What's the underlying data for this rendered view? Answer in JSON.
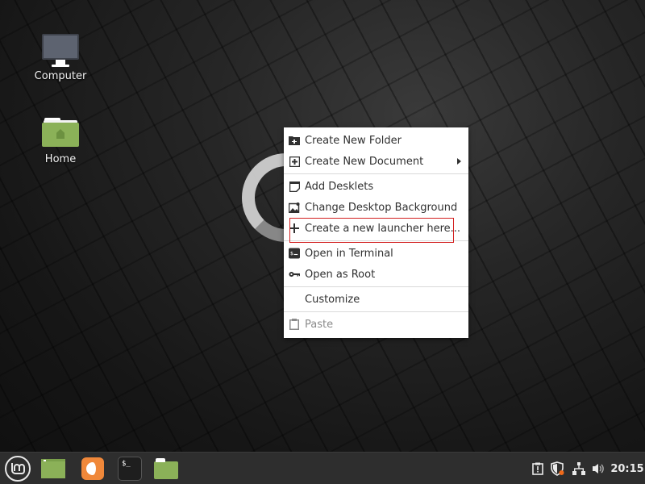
{
  "desktop": {
    "icons": [
      {
        "label": "Computer",
        "icon": "computer-icon"
      },
      {
        "label": "Home",
        "icon": "home-folder-icon"
      }
    ]
  },
  "context_menu": {
    "items": [
      {
        "label": "Create New Folder",
        "icon": "new-folder-icon",
        "enabled": true
      },
      {
        "label": "Create New Document",
        "icon": "new-document-icon",
        "enabled": true,
        "submenu": true
      },
      {
        "label": "Add Desklets",
        "icon": "desklet-icon",
        "enabled": true
      },
      {
        "label": "Change Desktop Background",
        "icon": "image-icon",
        "enabled": true
      },
      {
        "label": "Create a new launcher here...",
        "icon": "plus-icon",
        "enabled": true,
        "highlighted": true
      },
      {
        "label": "Open in Terminal",
        "icon": "terminal-icon",
        "enabled": true
      },
      {
        "label": "Open as Root",
        "icon": "key-icon",
        "enabled": true
      },
      {
        "label": "Customize",
        "icon": "",
        "enabled": true
      },
      {
        "label": "Paste",
        "icon": "clipboard-icon",
        "enabled": false
      }
    ],
    "highlight_color": "#d32020"
  },
  "panel": {
    "launchers": [
      {
        "name": "menu",
        "icon": "mint-menu-icon"
      },
      {
        "name": "show-desktop",
        "icon": "show-desktop-icon"
      },
      {
        "name": "firefox",
        "icon": "firefox-icon"
      },
      {
        "name": "terminal",
        "icon": "terminal-icon",
        "text": "$_"
      },
      {
        "name": "files",
        "icon": "files-icon"
      }
    ],
    "tray": {
      "icons": [
        "notifications-icon",
        "update-shield-icon",
        "network-icon",
        "volume-icon"
      ],
      "clock": "20:15"
    }
  }
}
